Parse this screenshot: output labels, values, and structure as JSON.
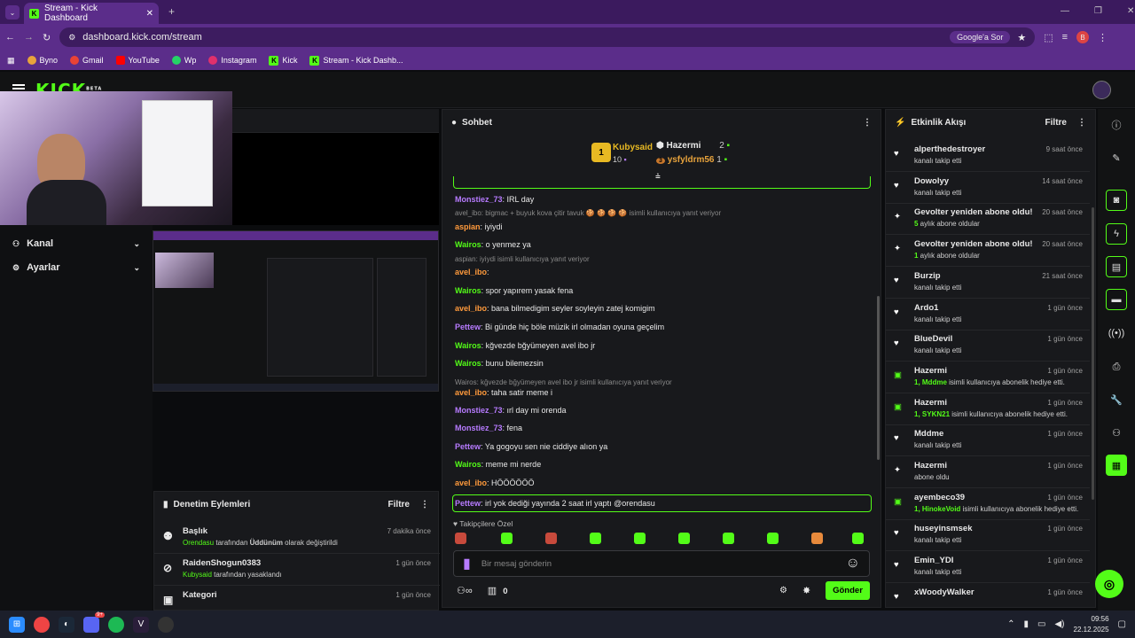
{
  "browser": {
    "tab_title": "Stream - Kick Dashboard",
    "url": "dashboard.kick.com/stream",
    "google_button": "Google'a Sor",
    "profile_initial": "B",
    "bookmarks": [
      "Byno",
      "Gmail",
      "YouTube",
      "Wp",
      "Instagram",
      "Kick",
      "Stream - Kick Dashb..."
    ]
  },
  "kick": {
    "logo": "KICK",
    "beta": "BETA"
  },
  "left_nav": {
    "items": [
      {
        "label": "Kanal",
        "icon": "channel-icon"
      },
      {
        "label": "Ayarlar",
        "icon": "gear-icon"
      }
    ]
  },
  "moderation": {
    "title": "Denetim Eylemleri",
    "filter": "Filtre",
    "rows": [
      {
        "title": "Başlık",
        "actor": "Orendasu",
        "mid": " tarafından ",
        "value": "Üddünüm",
        "tail": " olarak değiştirildi",
        "time": "7 dakika önce"
      },
      {
        "title": "RaidenShogun0383",
        "actor": "Kubysaid",
        "mid": " tarafından yasaklandı",
        "value": "",
        "tail": "",
        "time": "1 gün önce"
      },
      {
        "title": "Kategori",
        "actor": "",
        "mid": "",
        "value": "",
        "tail": "",
        "time": "1 gün önce"
      }
    ]
  },
  "chat": {
    "title": "Sohbet",
    "leader1": {
      "name": "Kubysaid",
      "rank": "1",
      "count": "10"
    },
    "leader2": {
      "name": "Hazermi",
      "count": "2"
    },
    "leader3": {
      "name": "ysfyldrm56",
      "rank": "3",
      "count": "1"
    },
    "messages": [
      {
        "user": "Monstiez_73",
        "color": "#b77bff",
        "text": ": IRL day"
      },
      {
        "reply": "avel_ibo: bigmac + buyuk kova çitir tavuk 🍪 🍪 🍪 🍪 isimli kullanıcıya yanıt veriyor"
      },
      {
        "user": "aspian",
        "color": "#ff9a3c",
        "text": ": iyiydi"
      },
      {
        "user": "Wairos",
        "color": "#53fc18",
        "text": ": o yenmez ya"
      },
      {
        "reply": "aspian: iyiydi isimli kullanıcıya yanıt veriyor"
      },
      {
        "user": "avel_ibo",
        "color": "#ff9a3c",
        "text": ":"
      },
      {
        "user": "Wairos",
        "color": "#53fc18",
        "text": ": spor yapırem yasak fena"
      },
      {
        "user": "avel_ibo",
        "color": "#ff9a3c",
        "text": ": bana bilmedigim seyler soyleyin zatej komigim"
      },
      {
        "user": "Pettew",
        "color": "#b77bff",
        "text": ": Bi günde hiç böle müzik irl olmadan oyuna geçelim"
      },
      {
        "user": "Wairos",
        "color": "#53fc18",
        "text": ": kğvezde bğyümeyen avel ibo jr"
      },
      {
        "user": "Wairos",
        "color": "#53fc18",
        "text": ": bunu bilemezsin"
      },
      {
        "reply": "Wairos: kğvezde bğyümeyen avel ibo jr isimli kullanıcıya yanıt veriyor"
      },
      {
        "user": "avel_ibo",
        "color": "#ff9a3c",
        "text": ": taha satir meme i"
      },
      {
        "user": "Monstiez_73",
        "color": "#b77bff",
        "text": ": ırl day mi orenda"
      },
      {
        "user": "Monstiez_73",
        "color": "#b77bff",
        "text": ": fena"
      },
      {
        "user": "Pettew",
        "color": "#b77bff",
        "text": ": Ya gogoyu sen nie ciddiye alıon ya"
      },
      {
        "user": "Wairos",
        "color": "#53fc18",
        "text": ": meme mi nerde"
      },
      {
        "user": "avel_ibo",
        "color": "#ff9a3c",
        "text": ": HÖÖÖÖÖÖ"
      }
    ],
    "highlight": {
      "user": "Pettew",
      "text": ": irl yok dediği yayında 2 saat irl yaptı @orendasu"
    },
    "subs_only": "Takipçilere Özel",
    "input_placeholder": "Bir mesaj gönderin",
    "points": "0",
    "send": "Gönder"
  },
  "activity": {
    "title": "Etkinlik Akışı",
    "filter": "Filtre",
    "items": [
      {
        "icon": "heart-icon",
        "name": "alperthedestroyer",
        "time": "9 saat önce",
        "hl": "",
        "sub": "kanalı takip etti"
      },
      {
        "icon": "heart-icon",
        "name": "Dowolyy",
        "time": "14 saat önce",
        "hl": "",
        "sub": "kanalı takip etti"
      },
      {
        "icon": "sparkle-icon",
        "name": "Gevolter yeniden abone oldu!",
        "time": "20 saat önce",
        "hl": "5",
        "sub": " aylık abone oldular"
      },
      {
        "icon": "sparkle-icon",
        "name": "Gevolter yeniden abone oldu!",
        "time": "20 saat önce",
        "hl": "1",
        "sub": " aylık abone oldular"
      },
      {
        "icon": "heart-icon",
        "name": "Burzip",
        "time": "21 saat önce",
        "hl": "",
        "sub": "kanalı takip etti"
      },
      {
        "icon": "heart-icon",
        "name": "Ardo1",
        "time": "1 gün önce",
        "hl": "",
        "sub": "kanalı takip etti"
      },
      {
        "icon": "heart-icon",
        "name": "BlueDevil",
        "time": "1 gün önce",
        "hl": "",
        "sub": "kanalı takip etti"
      },
      {
        "icon": "gift-icon",
        "name": "Hazermi",
        "time": "1 gün önce",
        "hl": "1, Mddme",
        "sub": " isimli kullanıcıya abonelik hediye etti."
      },
      {
        "icon": "gift-icon",
        "name": "Hazermi",
        "time": "1 gün önce",
        "hl": "1, SYKN21",
        "sub": " isimli kullanıcıya abonelik hediye etti."
      },
      {
        "icon": "heart-icon",
        "name": "Mddme",
        "time": "1 gün önce",
        "hl": "",
        "sub": "kanalı takip etti"
      },
      {
        "icon": "sparkle-icon",
        "name": "Hazermi",
        "time": "1 gün önce",
        "hl": "",
        "sub": "abone oldu"
      },
      {
        "icon": "gift-icon",
        "name": "ayembeco39",
        "time": "1 gün önce",
        "hl": "1, HinokeVoid",
        "sub": " isimli kullanıcıya abonelik hediye etti."
      },
      {
        "icon": "heart-icon",
        "name": "huseyinsmsek",
        "time": "1 gün önce",
        "hl": "",
        "sub": "kanalı takip etti"
      },
      {
        "icon": "heart-icon",
        "name": "Emin_YDI",
        "time": "1 gün önce",
        "hl": "",
        "sub": "kanalı takip etti"
      },
      {
        "icon": "heart-icon",
        "name": "xWoodyWalker",
        "time": "1 gün önce",
        "hl": "",
        "sub": ""
      }
    ]
  },
  "taskbar": {
    "time": "09:56",
    "date": "22.12.2025",
    "discord_badge": "9+"
  },
  "colors": {
    "accent": "#53fc18",
    "purple": "#5b2d8a",
    "bg": "#0b0c0e",
    "panel": "#18191c"
  }
}
